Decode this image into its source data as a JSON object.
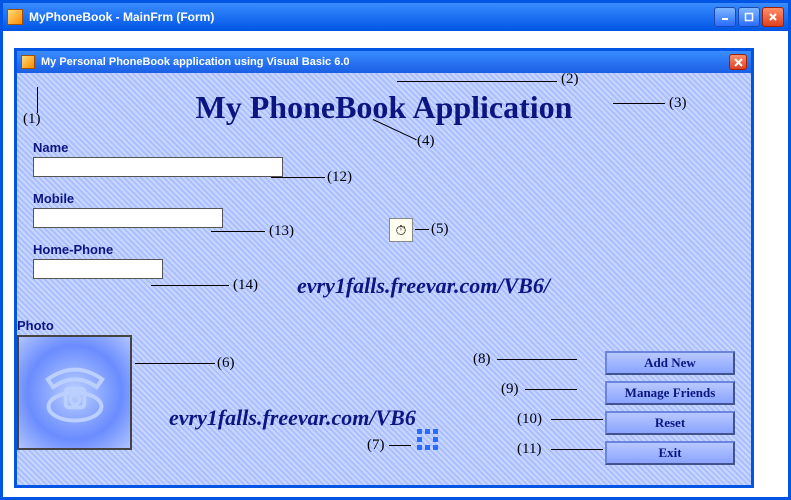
{
  "outer": {
    "title": "MyPhoneBook - MainFrm (Form)"
  },
  "inner": {
    "title": "My Personal PhoneBook application using Visual Basic 6.0",
    "heading": "My PhoneBook Application"
  },
  "fields": {
    "name": {
      "label": "Name",
      "value": ""
    },
    "mobile": {
      "label": "Mobile",
      "value": ""
    },
    "home": {
      "label": "Home-Phone",
      "value": ""
    },
    "photo": {
      "label": "Photo"
    }
  },
  "buttons": {
    "add": "Add New",
    "manage": "Manage Friends",
    "reset": "Reset",
    "exit": "Exit"
  },
  "watermarks": {
    "w1": "evry1falls.freevar.com/VB6/",
    "w2": "evry1falls.freevar.com/VB6"
  },
  "annotations": {
    "a1": "(1)",
    "a2": "(2)",
    "a3": "(3)",
    "a4": "(4)",
    "a5": "(5)",
    "a6": "(6)",
    "a7": "(7)",
    "a8": "(8)",
    "a9": "(9)",
    "a10": "(10)",
    "a11": "(11)",
    "a12": "(12)",
    "a13": "(13)",
    "a14": "(14)"
  },
  "timer_glyph": "⏱"
}
